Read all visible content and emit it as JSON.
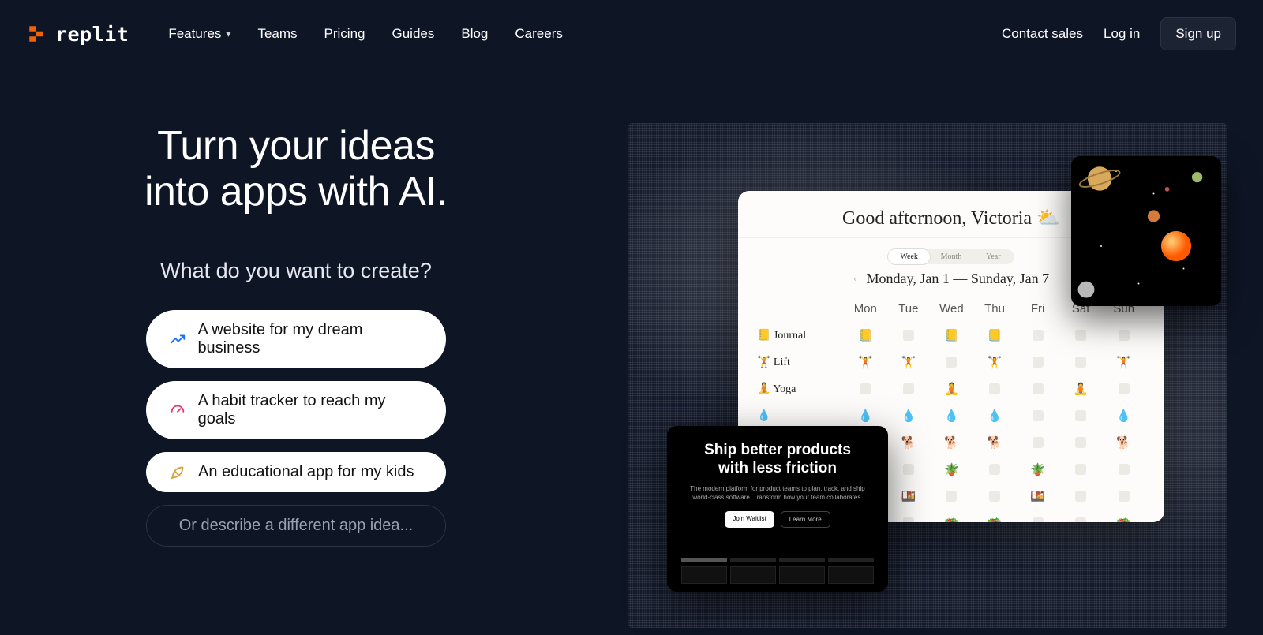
{
  "nav": {
    "logo_text": "replit",
    "links": [
      "Features",
      "Teams",
      "Pricing",
      "Guides",
      "Blog",
      "Careers"
    ],
    "contact": "Contact sales",
    "login": "Log in",
    "signup": "Sign up"
  },
  "hero": {
    "title_line1": "Turn your ideas",
    "title_line2": "into apps with AI.",
    "subtitle": "What do you want to create?",
    "suggestions": [
      {
        "icon": "trend-up-icon",
        "label": "A website for my dream business"
      },
      {
        "icon": "gauge-icon",
        "label": "A habit tracker to reach my goals"
      },
      {
        "icon": "rocket-icon",
        "label": "An educational app for my kids"
      }
    ],
    "input_placeholder": "Or describe a different app idea..."
  },
  "tracker_card": {
    "greeting": "Good afternoon, Victoria",
    "weather_icon": "⛅",
    "tabs": [
      "Week",
      "Month",
      "Year"
    ],
    "active_tab": "Week",
    "date_range": "Monday, Jan 1 — Sunday, Jan 7",
    "day_headers": [
      "Mon",
      "Tue",
      "Wed",
      "Thu",
      "Fri",
      "Sat",
      "Sun"
    ],
    "habits": [
      {
        "emoji": "📒",
        "name": "Journal",
        "cells": [
          "📒",
          "",
          "📒",
          "📒",
          "",
          "",
          ""
        ]
      },
      {
        "emoji": "🏋️",
        "name": "Lift",
        "cells": [
          "🏋️",
          "🏋️",
          "",
          "🏋️",
          "",
          "",
          "🏋️"
        ]
      },
      {
        "emoji": "🧘",
        "name": "Yoga",
        "cells": [
          "",
          "",
          "🧘",
          "",
          "",
          "🧘",
          ""
        ]
      },
      {
        "emoji": "💧",
        "name": "",
        "cells": [
          "💧",
          "💧",
          "💧",
          "💧",
          "",
          "",
          "💧"
        ]
      },
      {
        "emoji": "🐕",
        "name": "",
        "cells": [
          "🐕",
          "🐕",
          "🐕",
          "🐕",
          "",
          "",
          "🐕"
        ]
      },
      {
        "emoji": "🪴",
        "name": "",
        "cells": [
          "🪴",
          "",
          "🪴",
          "",
          "🪴",
          "",
          ""
        ]
      },
      {
        "emoji": "🍱",
        "name": "",
        "cells": [
          "",
          "🍱",
          "",
          "",
          "🍱",
          "",
          ""
        ]
      },
      {
        "emoji": "🥗",
        "name": "",
        "cells": [
          "🥗",
          "",
          "🥗",
          "🥗",
          "",
          "",
          "🥗"
        ]
      }
    ]
  },
  "product_card": {
    "title_line1": "Ship better products",
    "title_line2": "with less friction",
    "body": "The modern platform for product teams to plan, track, and ship world-class software. Transform how your team collaborates.",
    "primary_btn": "Join Waitlist",
    "secondary_btn": "Learn More"
  },
  "planets_card": {
    "name": "solar-system-preview"
  }
}
